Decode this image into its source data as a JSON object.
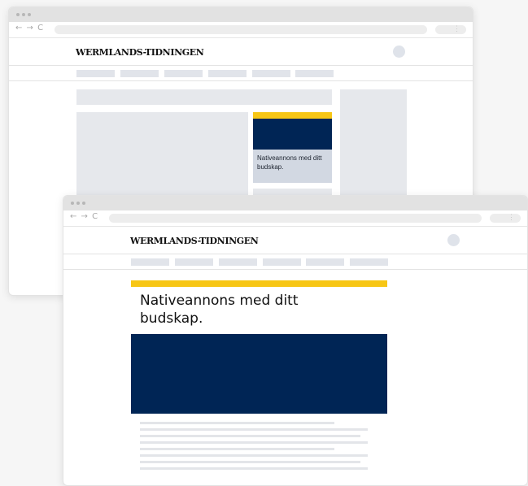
{
  "back_window": {
    "nav_glyphs": "← → C",
    "kebab_glyph": "⋮",
    "logo": "WERMLANDS-TIDNINGEN",
    "native_ad_caption": "Nativeannons med ditt budskap.",
    "native_ad_colors": {
      "stripe": "#f7c615",
      "image": "#002555",
      "caption_bg": "#d2d8e2"
    }
  },
  "front_window": {
    "nav_glyphs": "← → C",
    "kebab_glyph": "⋮",
    "logo": "WERMLANDS-TIDNINGEN",
    "native_ad_headline": "Nativeannons med ditt budskap.",
    "native_ad_colors": {
      "stripe": "#f7c615",
      "image": "#002555"
    }
  }
}
